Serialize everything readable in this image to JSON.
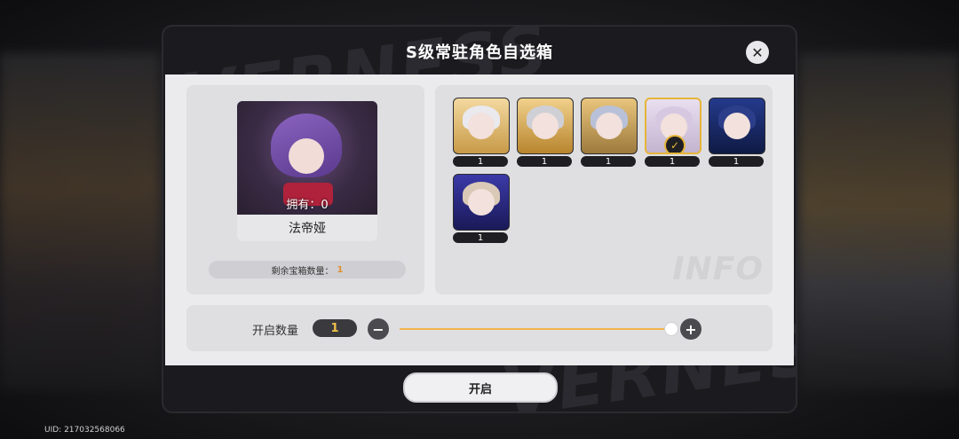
{
  "dialog": {
    "title": "S级常驻角色自选箱",
    "close_icon": "close-icon",
    "watermark": "VERNESS"
  },
  "selected_character": {
    "owned_text": "拥有：0",
    "name": "法帝娅",
    "remaining_label": "剩余宝箱数量：",
    "remaining_value": "1"
  },
  "characters": [
    {
      "count": "1",
      "selected": false,
      "hair": "#e9e9ee"
    },
    {
      "count": "1",
      "selected": false,
      "hair": "#cfcfd6"
    },
    {
      "count": "1",
      "selected": false,
      "hair": "#b9c1d8"
    },
    {
      "count": "1",
      "selected": true,
      "hair": "#d7c8e2"
    },
    {
      "count": "1",
      "selected": false,
      "hair": "#2c3e8a"
    },
    {
      "count": "1",
      "selected": false,
      "hair": "#d9c9b6"
    }
  ],
  "info_watermark": "INFO",
  "quantity": {
    "label": "开启数量",
    "value": "1",
    "minus_icon": "minus-icon",
    "plus_icon": "plus-icon",
    "slider_fraction": 1.0
  },
  "open_button": "开启",
  "uid_text": "UID: 217032568066",
  "colors": {
    "accent": "#e6b53a",
    "slider": "#f0b54a",
    "panel": "#dfdfe2"
  }
}
